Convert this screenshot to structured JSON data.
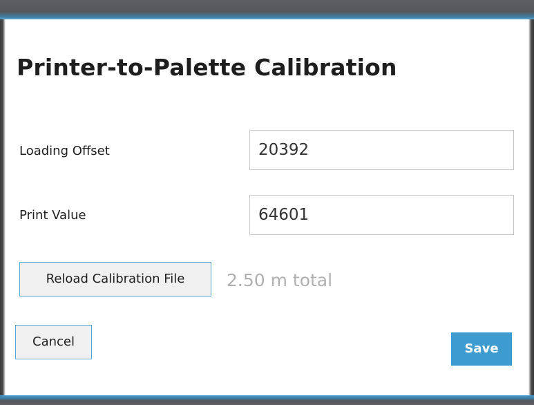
{
  "dialog": {
    "title": "Printer-to-Palette Calibration",
    "fields": [
      {
        "label": "Loading Offset",
        "value": "20392"
      },
      {
        "label": "Print Value",
        "value": "64601"
      }
    ],
    "reload_button_label": "Reload Calibration File",
    "total_text": "2.50 m total",
    "cancel_label": "Cancel",
    "save_label": "Save"
  },
  "colors": {
    "accent": "#3d9bd0",
    "frame": "#55575c",
    "muted_text": "#b0b0b0"
  }
}
